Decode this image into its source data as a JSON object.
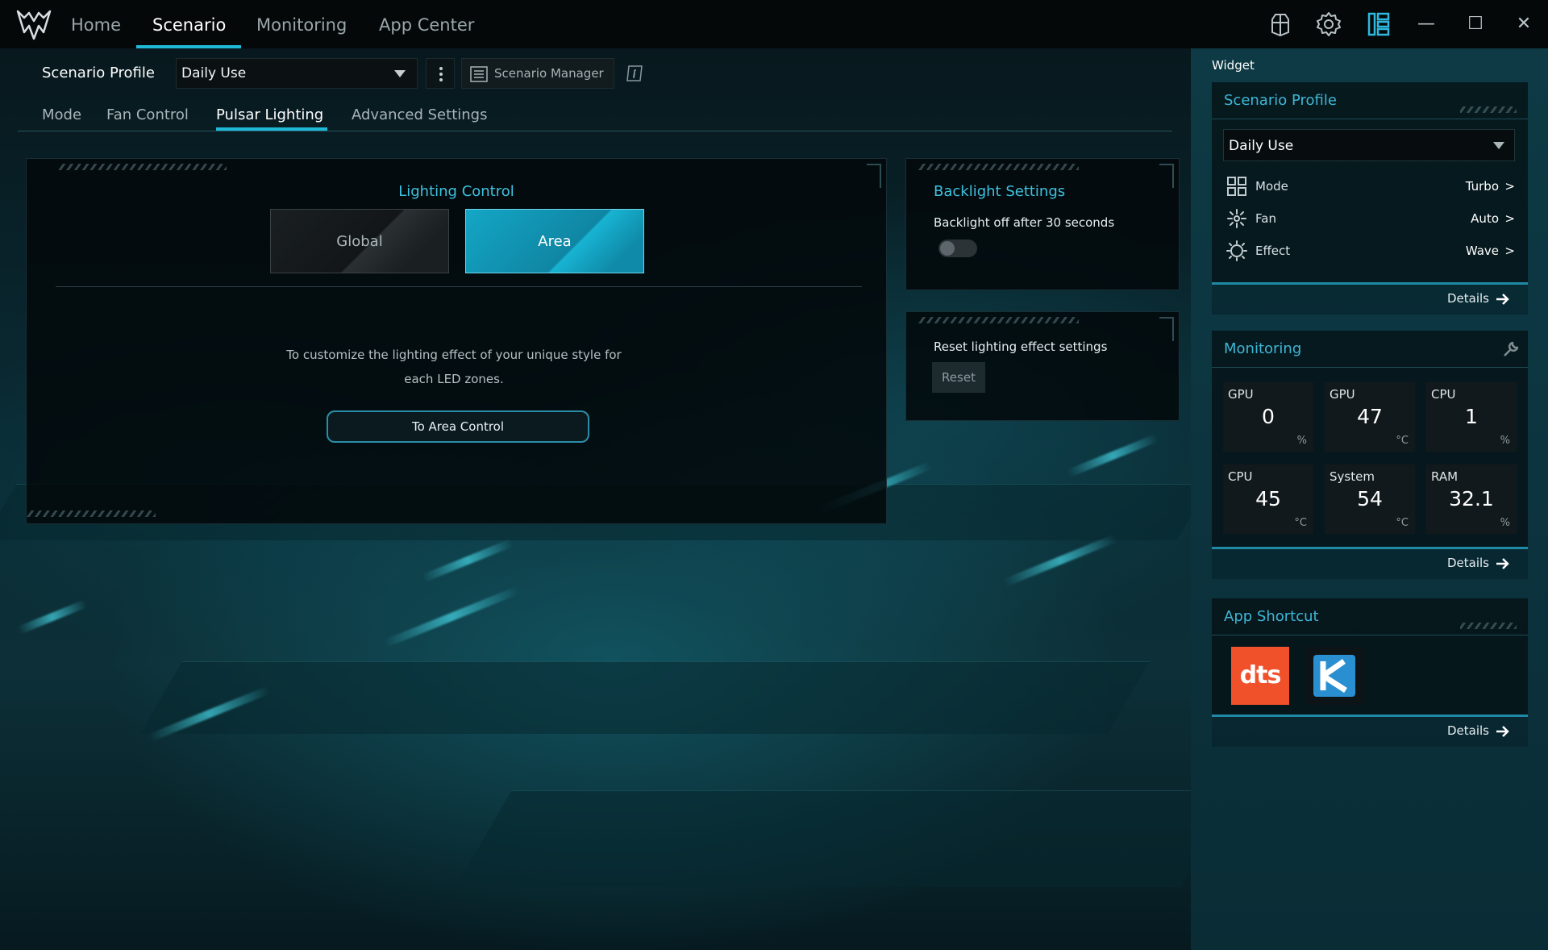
{
  "window": {
    "nav": [
      "Home",
      "Scenario",
      "Monitoring",
      "App Center"
    ],
    "active_nav": "Scenario",
    "icons": [
      "predator-logo-icon",
      "controller-icon",
      "settings-gear-icon",
      "widget-toggle-icon",
      "minimize-icon",
      "maximize-icon",
      "close-icon"
    ],
    "win_controls": {
      "minimize": "—",
      "maximize": "☐",
      "close": "✕"
    }
  },
  "profile": {
    "label": "Scenario Profile",
    "selected": "Daily Use",
    "manager_label": "Scenario Manager"
  },
  "tabs": [
    "Mode",
    "Fan Control",
    "Pulsar Lighting",
    "Advanced Settings"
  ],
  "active_tab": "Pulsar Lighting",
  "lighting": {
    "title": "Lighting Control",
    "global_label": "Global",
    "area_label": "Area",
    "selected": "Area",
    "description": "To customize the lighting effect of your unique style for each LED zones.",
    "area_control_label": "To Area Control"
  },
  "backlight": {
    "title": "Backlight Settings",
    "text": "Backlight off after 30 seconds",
    "enabled": false
  },
  "reset": {
    "text": "Reset lighting effect settings",
    "button": "Reset"
  },
  "widget": {
    "title": "Widget",
    "scenario_profile": {
      "title": "Scenario Profile",
      "selected": "Daily Use",
      "rows": [
        {
          "key": "Mode",
          "value": "Turbo",
          "icon": "mode-grid-icon"
        },
        {
          "key": "Fan",
          "value": "Auto",
          "icon": "fan-icon"
        },
        {
          "key": "Effect",
          "value": "Wave",
          "icon": "effect-sun-icon"
        }
      ],
      "chevron": ">",
      "details": "Details"
    },
    "monitoring": {
      "title": "Monitoring",
      "tiles": [
        {
          "name": "GPU",
          "value": "0",
          "unit": "%"
        },
        {
          "name": "GPU",
          "value": "47",
          "unit": "°C"
        },
        {
          "name": "CPU",
          "value": "1",
          "unit": "%"
        },
        {
          "name": "CPU",
          "value": "45",
          "unit": "°C"
        },
        {
          "name": "System",
          "value": "54",
          "unit": "°C"
        },
        {
          "name": "RAM",
          "value": "32.1",
          "unit": "%"
        }
      ],
      "details": "Details"
    },
    "app_shortcut": {
      "title": "App Shortcut",
      "apps": [
        "DTS",
        "Killer"
      ],
      "dts_logo_text": "dts",
      "details": "Details"
    }
  },
  "colors": {
    "accent": "#1fb8d6",
    "title_cyan": "#3fc2df",
    "dts_orange": "#f0512b",
    "killer_blue": "#2a8fd0"
  }
}
